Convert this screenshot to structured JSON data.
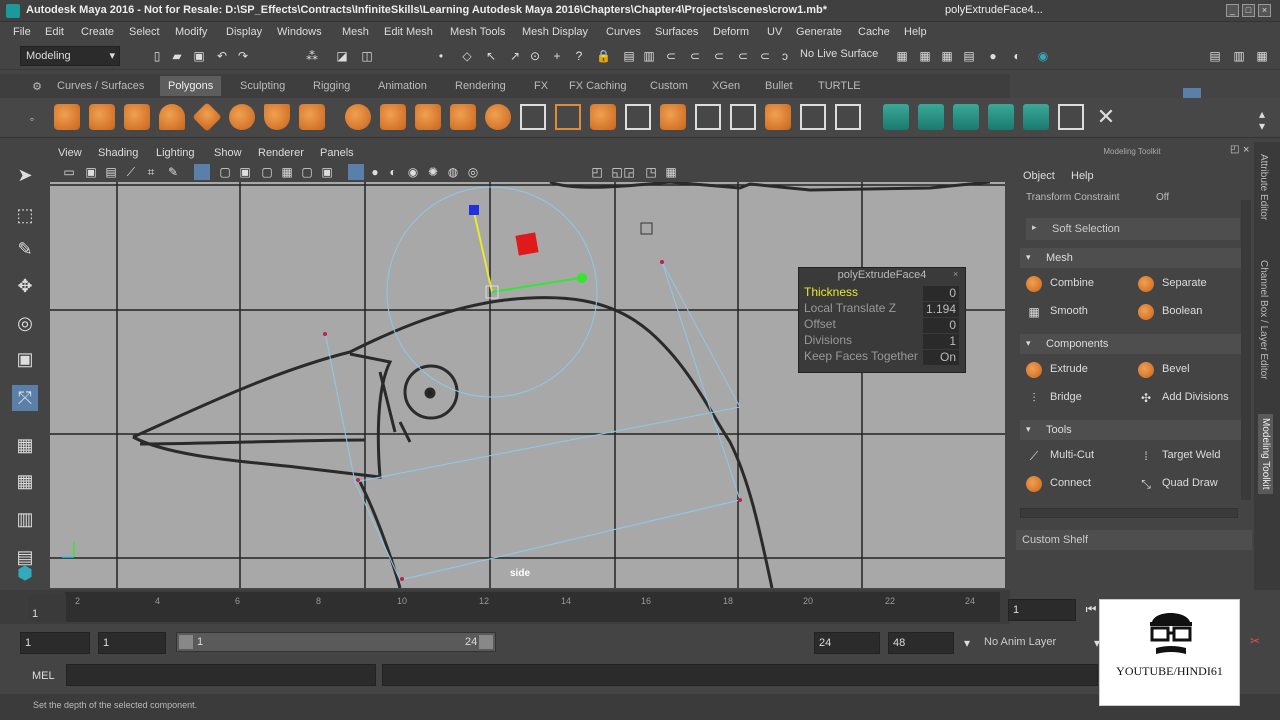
{
  "window": {
    "title": "Autodesk Maya 2016 - Not for Resale: D:\\SP_Effects\\Contracts\\InfiniteSkills\\Learning Autodesk Maya 2016\\Chapters\\Chapter4\\Projects\\scenes\\crow1.mb*",
    "right_title": "polyExtrudeFace4...",
    "min": "_",
    "max": "□",
    "close": "×"
  },
  "menu": [
    "File",
    "Edit",
    "Create",
    "Select",
    "Modify",
    "Display",
    "Windows",
    "Mesh",
    "Edit Mesh",
    "Mesh Tools",
    "Mesh Display",
    "Curves",
    "Surfaces",
    "Deform",
    "UV",
    "Generate",
    "Cache",
    "Help"
  ],
  "status": {
    "mode": "Modeling",
    "live_surface": "No Live Surface"
  },
  "shelf_tabs": [
    "Curves / Surfaces",
    "Polygons",
    "Sculpting",
    "Rigging",
    "Animation",
    "Rendering",
    "FX",
    "FX Caching",
    "Custom",
    "XGen",
    "Bullet",
    "TURTLE"
  ],
  "viewport": {
    "menu": [
      "View",
      "Shading",
      "Lighting",
      "Show",
      "Renderer",
      "Panels"
    ],
    "camera_label": "side"
  },
  "hud": {
    "title": "polyExtrudeFace4",
    "rows": [
      {
        "label": "Thickness",
        "value": "0"
      },
      {
        "label": "Local Translate Z",
        "value": "1.194"
      },
      {
        "label": "Offset",
        "value": "0"
      },
      {
        "label": "Divisions",
        "value": "1"
      },
      {
        "label": "Keep Faces Together",
        "value": "On"
      }
    ]
  },
  "panel": {
    "title": "Modeling Toolkit",
    "menu": [
      "Object",
      "Help"
    ],
    "transform_constraint": "Transform Constraint",
    "constraint_value": "Off",
    "soft_selection": "Soft Selection",
    "mesh_header": "Mesh",
    "mesh": [
      "Combine",
      "Separate",
      "Smooth",
      "Boolean"
    ],
    "components_header": "Components",
    "components": [
      "Extrude",
      "Bevel",
      "Bridge",
      "Add Divisions"
    ],
    "tools_header": "Tools",
    "tools": [
      "Multi-Cut",
      "Target Weld",
      "Connect",
      "Quad Draw"
    ],
    "custom_shelf": "Custom Shelf"
  },
  "side_tabs": [
    "Attribute Editor",
    "Channel Box / Layer Editor",
    "Modeling Toolkit"
  ],
  "timeline": {
    "ticks": [
      "2",
      "4",
      "6",
      "8",
      "10",
      "12",
      "14",
      "16",
      "18",
      "20",
      "22",
      "24"
    ],
    "current": "1",
    "current_field": "1"
  },
  "range": {
    "start": "1",
    "start2": "1",
    "slider_start": "1",
    "slider_end": "24",
    "end": "24",
    "end2": "48",
    "anim_layer": "No Anim Layer"
  },
  "cmd": {
    "label": "MEL"
  },
  "help": "Set the depth of the selected component.",
  "watermark": "YOUTUBE/HINDI61",
  "colors": {
    "viewport_bg": "#a8a8a8",
    "hud_highlight": "#e8e830",
    "accent_orange": "#e08a3c"
  }
}
